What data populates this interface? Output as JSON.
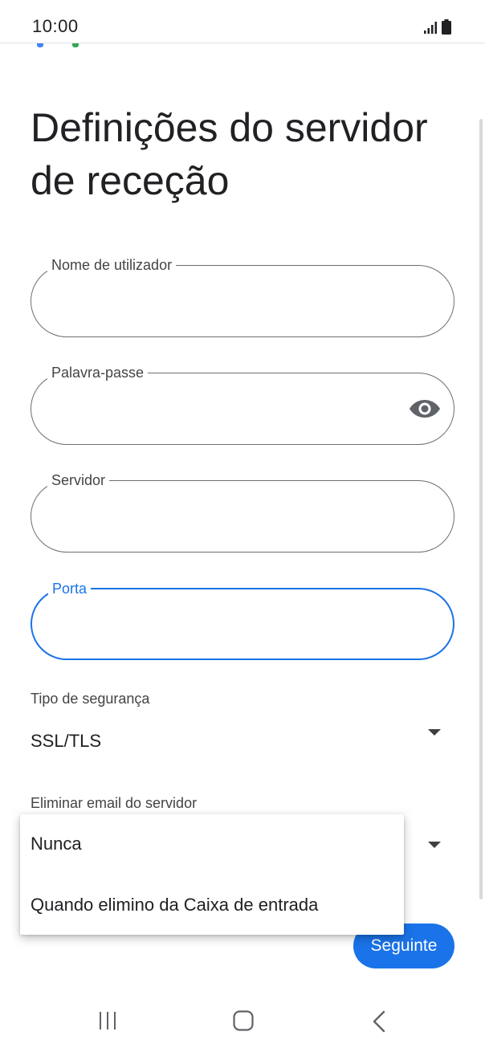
{
  "status_bar": {
    "time": "10:00"
  },
  "page": {
    "title": "Definições do servidor de receção"
  },
  "fields": {
    "username": {
      "label": "Nome de utilizador",
      "value": ""
    },
    "password": {
      "label": "Palavra-passe",
      "value": ""
    },
    "server": {
      "label": "Servidor",
      "value": ""
    },
    "port": {
      "label": "Porta",
      "value": ""
    }
  },
  "security": {
    "label": "Tipo de segurança",
    "value": "SSL/TLS"
  },
  "delete_email": {
    "label": "Eliminar email do servidor"
  },
  "dropdown": {
    "options": [
      "Nunca",
      "Quando elimino da Caixa de entrada"
    ]
  },
  "actions": {
    "next_label": "Seguinte"
  },
  "icons": {
    "eye": "eye-icon",
    "caret": "caret-down-icon",
    "recents": "recents-icon",
    "home": "home-icon",
    "back": "back-icon"
  },
  "colors": {
    "accent": "#1a73e8",
    "outline": "#6f6f6f",
    "text": "#202124"
  }
}
